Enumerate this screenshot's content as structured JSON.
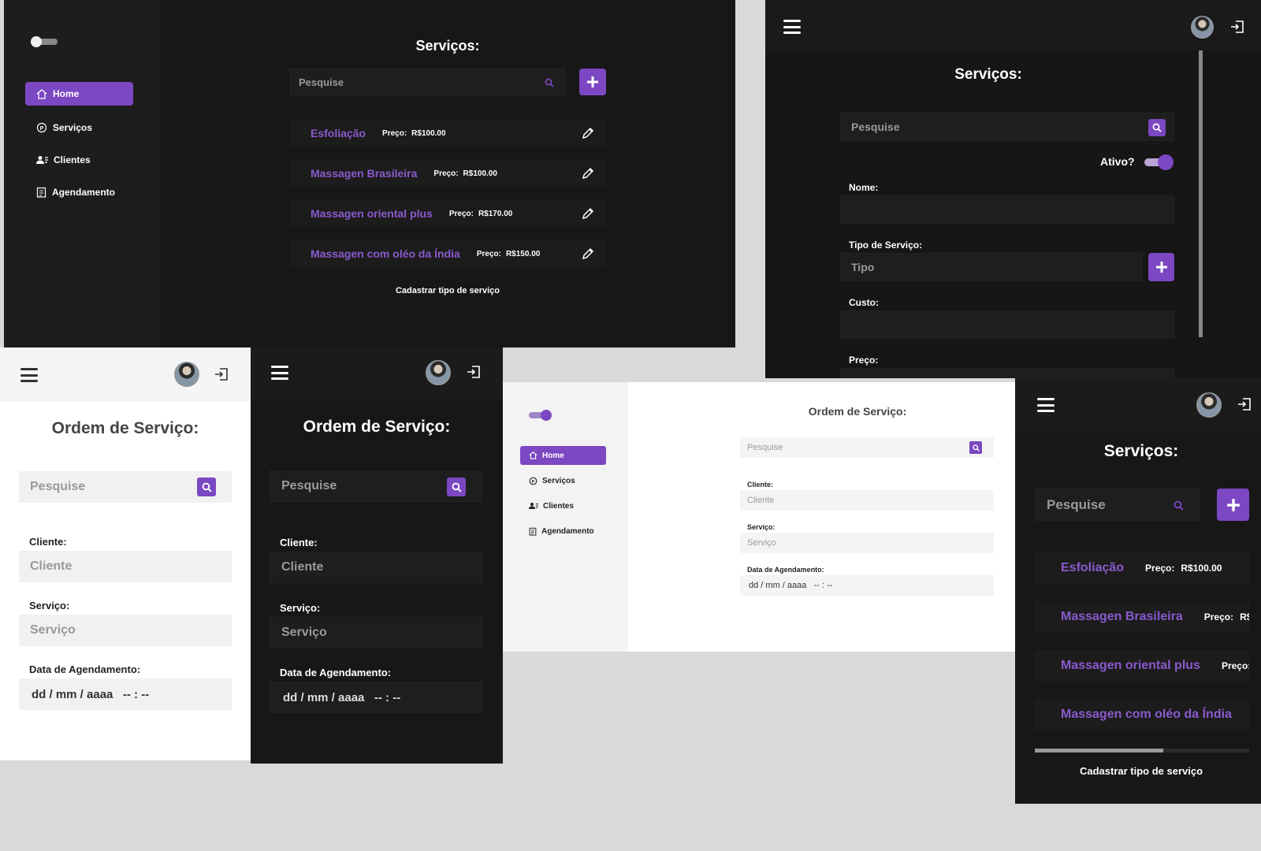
{
  "colors": {
    "accent": "#7b47c2",
    "accent_text": "#8a5acd",
    "dark_bg": "#151515",
    "light_bg": "#ffffff"
  },
  "nav": {
    "items": [
      {
        "label": "Home",
        "icon": "home-icon"
      },
      {
        "label": "Serviços",
        "icon": "p-circle-icon"
      },
      {
        "label": "Clientes",
        "icon": "users-icon"
      },
      {
        "label": "Agendamento",
        "icon": "clipboard-icon"
      }
    ]
  },
  "servicos_list": {
    "title": "Serviços:",
    "search_placeholder": "Pesquise",
    "price_label": "Preço:",
    "items": [
      {
        "name": "Esfoliação",
        "price": "R$100.00"
      },
      {
        "name": "Massagen Brasileira",
        "price": "R$100.00"
      },
      {
        "name": "Massagen oriental plus",
        "price": "R$170.00"
      },
      {
        "name": "Massagen com oléo da Índia",
        "price": "R$150.00"
      }
    ],
    "footer_link": "Cadastrar tipo de serviço"
  },
  "servico_form": {
    "title": "Serviços:",
    "search_placeholder": "Pesquise",
    "ativo_label": "Ativo?",
    "nome_label": "Nome:",
    "tipo_label": "Tipo de Serviço:",
    "tipo_placeholder": "Tipo",
    "custo_label": "Custo:",
    "preco_label": "Preço:"
  },
  "ordem": {
    "title": "Ordem de Serviço:",
    "search_placeholder": "Pesquise",
    "cliente_label": "Cliente:",
    "cliente_placeholder": "Cliente",
    "servico_label": "Serviço:",
    "servico_placeholder": "Serviço",
    "data_label": "Data de Agendamento:",
    "data_placeholder": "dd / mm / aaaa   -- : --"
  },
  "mobile_list": {
    "title": "Serviços:",
    "search_placeholder": "Pesquise",
    "price_label": "Preço:",
    "items": [
      {
        "name": "Esfoliação",
        "price": "R$100.00"
      },
      {
        "name": "Massagen Brasileira",
        "price": "R$"
      },
      {
        "name": "Massagen oriental plus",
        "price": ""
      },
      {
        "name": "Massagen com oléo da Índia",
        "price": ""
      }
    ],
    "footer_link": "Cadastrar tipo de serviço"
  }
}
